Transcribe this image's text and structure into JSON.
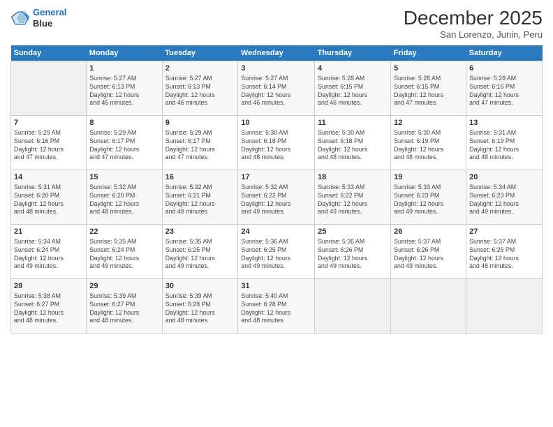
{
  "header": {
    "logo_line1": "General",
    "logo_line2": "Blue",
    "month": "December 2025",
    "location": "San Lorenzo, Junin, Peru"
  },
  "weekdays": [
    "Sunday",
    "Monday",
    "Tuesday",
    "Wednesday",
    "Thursday",
    "Friday",
    "Saturday"
  ],
  "weeks": [
    [
      {
        "day": "",
        "info": ""
      },
      {
        "day": "1",
        "info": "Sunrise: 5:27 AM\nSunset: 6:13 PM\nDaylight: 12 hours\nand 45 minutes."
      },
      {
        "day": "2",
        "info": "Sunrise: 5:27 AM\nSunset: 6:13 PM\nDaylight: 12 hours\nand 46 minutes."
      },
      {
        "day": "3",
        "info": "Sunrise: 5:27 AM\nSunset: 6:14 PM\nDaylight: 12 hours\nand 46 minutes."
      },
      {
        "day": "4",
        "info": "Sunrise: 5:28 AM\nSunset: 6:15 PM\nDaylight: 12 hours\nand 46 minutes."
      },
      {
        "day": "5",
        "info": "Sunrise: 5:28 AM\nSunset: 6:15 PM\nDaylight: 12 hours\nand 47 minutes."
      },
      {
        "day": "6",
        "info": "Sunrise: 5:28 AM\nSunset: 6:16 PM\nDaylight: 12 hours\nand 47 minutes."
      }
    ],
    [
      {
        "day": "7",
        "info": "Sunrise: 5:29 AM\nSunset: 6:16 PM\nDaylight: 12 hours\nand 47 minutes."
      },
      {
        "day": "8",
        "info": "Sunrise: 5:29 AM\nSunset: 6:17 PM\nDaylight: 12 hours\nand 47 minutes."
      },
      {
        "day": "9",
        "info": "Sunrise: 5:29 AM\nSunset: 6:17 PM\nDaylight: 12 hours\nand 47 minutes."
      },
      {
        "day": "10",
        "info": "Sunrise: 5:30 AM\nSunset: 6:18 PM\nDaylight: 12 hours\nand 48 minutes."
      },
      {
        "day": "11",
        "info": "Sunrise: 5:30 AM\nSunset: 6:18 PM\nDaylight: 12 hours\nand 48 minutes."
      },
      {
        "day": "12",
        "info": "Sunrise: 5:30 AM\nSunset: 6:19 PM\nDaylight: 12 hours\nand 48 minutes."
      },
      {
        "day": "13",
        "info": "Sunrise: 5:31 AM\nSunset: 6:19 PM\nDaylight: 12 hours\nand 48 minutes."
      }
    ],
    [
      {
        "day": "14",
        "info": "Sunrise: 5:31 AM\nSunset: 6:20 PM\nDaylight: 12 hours\nand 48 minutes."
      },
      {
        "day": "15",
        "info": "Sunrise: 5:32 AM\nSunset: 6:20 PM\nDaylight: 12 hours\nand 48 minutes."
      },
      {
        "day": "16",
        "info": "Sunrise: 5:32 AM\nSunset: 6:21 PM\nDaylight: 12 hours\nand 48 minutes."
      },
      {
        "day": "17",
        "info": "Sunrise: 5:32 AM\nSunset: 6:22 PM\nDaylight: 12 hours\nand 49 minutes."
      },
      {
        "day": "18",
        "info": "Sunrise: 5:33 AM\nSunset: 6:22 PM\nDaylight: 12 hours\nand 49 minutes."
      },
      {
        "day": "19",
        "info": "Sunrise: 5:33 AM\nSunset: 6:23 PM\nDaylight: 12 hours\nand 49 minutes."
      },
      {
        "day": "20",
        "info": "Sunrise: 5:34 AM\nSunset: 6:23 PM\nDaylight: 12 hours\nand 49 minutes."
      }
    ],
    [
      {
        "day": "21",
        "info": "Sunrise: 5:34 AM\nSunset: 6:24 PM\nDaylight: 12 hours\nand 49 minutes."
      },
      {
        "day": "22",
        "info": "Sunrise: 5:35 AM\nSunset: 6:24 PM\nDaylight: 12 hours\nand 49 minutes."
      },
      {
        "day": "23",
        "info": "Sunrise: 5:35 AM\nSunset: 6:25 PM\nDaylight: 12 hours\nand 49 minutes."
      },
      {
        "day": "24",
        "info": "Sunrise: 5:36 AM\nSunset: 6:25 PM\nDaylight: 12 hours\nand 49 minutes."
      },
      {
        "day": "25",
        "info": "Sunrise: 5:36 AM\nSunset: 6:26 PM\nDaylight: 12 hours\nand 49 minutes."
      },
      {
        "day": "26",
        "info": "Sunrise: 5:37 AM\nSunset: 6:26 PM\nDaylight: 12 hours\nand 49 minutes."
      },
      {
        "day": "27",
        "info": "Sunrise: 5:37 AM\nSunset: 6:26 PM\nDaylight: 12 hours\nand 48 minutes."
      }
    ],
    [
      {
        "day": "28",
        "info": "Sunrise: 5:38 AM\nSunset: 6:27 PM\nDaylight: 12 hours\nand 48 minutes."
      },
      {
        "day": "29",
        "info": "Sunrise: 5:39 AM\nSunset: 6:27 PM\nDaylight: 12 hours\nand 48 minutes."
      },
      {
        "day": "30",
        "info": "Sunrise: 5:39 AM\nSunset: 6:28 PM\nDaylight: 12 hours\nand 48 minutes."
      },
      {
        "day": "31",
        "info": "Sunrise: 5:40 AM\nSunset: 6:28 PM\nDaylight: 12 hours\nand 48 minutes."
      },
      {
        "day": "",
        "info": ""
      },
      {
        "day": "",
        "info": ""
      },
      {
        "day": "",
        "info": ""
      }
    ]
  ]
}
